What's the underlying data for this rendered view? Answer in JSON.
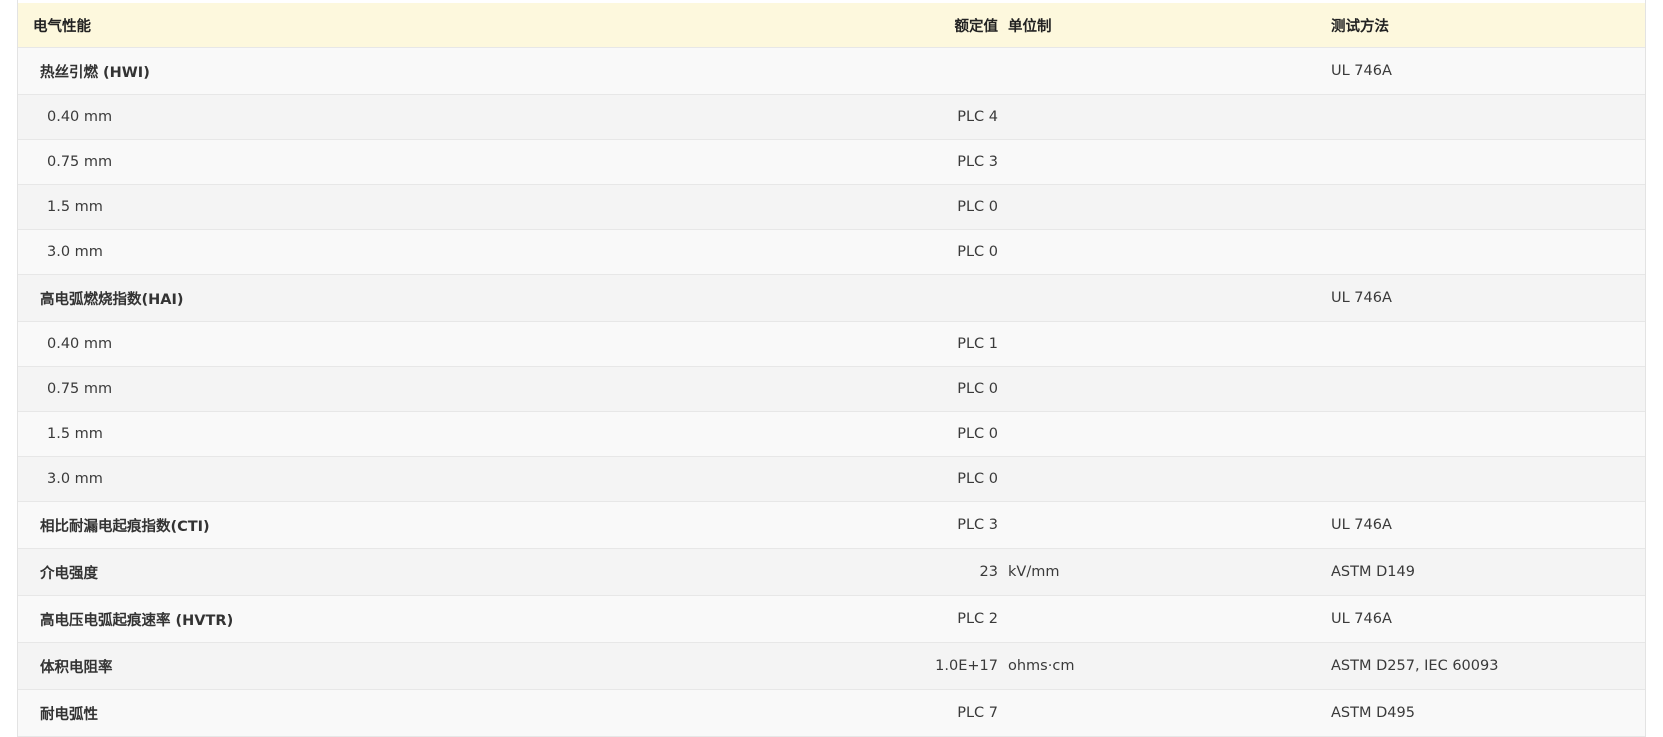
{
  "table": {
    "headers": {
      "property": "电气性能",
      "value": "额定值",
      "unit": "单位制",
      "method": "测试方法"
    },
    "rows": [
      {
        "kind": "group",
        "property": "热丝引燃 (HWI)",
        "value": "",
        "unit": "",
        "method": "UL 746A"
      },
      {
        "kind": "sub",
        "property": "0.40 mm",
        "value": "PLC 4",
        "unit": "",
        "method": ""
      },
      {
        "kind": "sub",
        "property": "0.75 mm",
        "value": "PLC 3",
        "unit": "",
        "method": ""
      },
      {
        "kind": "sub",
        "property": "1.5 mm",
        "value": "PLC 0",
        "unit": "",
        "method": ""
      },
      {
        "kind": "sub",
        "property": "3.0 mm",
        "value": "PLC 0",
        "unit": "",
        "method": ""
      },
      {
        "kind": "group",
        "property": "高电弧燃烧指数(HAI)",
        "value": "",
        "unit": "",
        "method": "UL 746A"
      },
      {
        "kind": "sub",
        "property": "0.40 mm",
        "value": "PLC 1",
        "unit": "",
        "method": ""
      },
      {
        "kind": "sub",
        "property": "0.75 mm",
        "value": "PLC 0",
        "unit": "",
        "method": ""
      },
      {
        "kind": "sub",
        "property": "1.5 mm",
        "value": "PLC 0",
        "unit": "",
        "method": ""
      },
      {
        "kind": "sub",
        "property": "3.0 mm",
        "value": "PLC 0",
        "unit": "",
        "method": ""
      },
      {
        "kind": "group",
        "property": "相比耐漏电起痕指数(CTI)",
        "value": "PLC 3",
        "unit": "",
        "method": "UL 746A"
      },
      {
        "kind": "group",
        "property": "介电强度",
        "value": "23",
        "unit": "kV/mm",
        "method": "ASTM D149"
      },
      {
        "kind": "group",
        "property": "高电压电弧起痕速率 (HVTR)",
        "value": "PLC 2",
        "unit": "",
        "method": "UL 746A"
      },
      {
        "kind": "group",
        "property": "体积电阻率",
        "value": "1.0E+17",
        "unit": "ohms·cm",
        "method": "ASTM D257, IEC 60093"
      },
      {
        "kind": "group",
        "property": "耐电弧性",
        "value": "PLC 7",
        "unit": "",
        "method": "ASTM D495"
      }
    ]
  }
}
